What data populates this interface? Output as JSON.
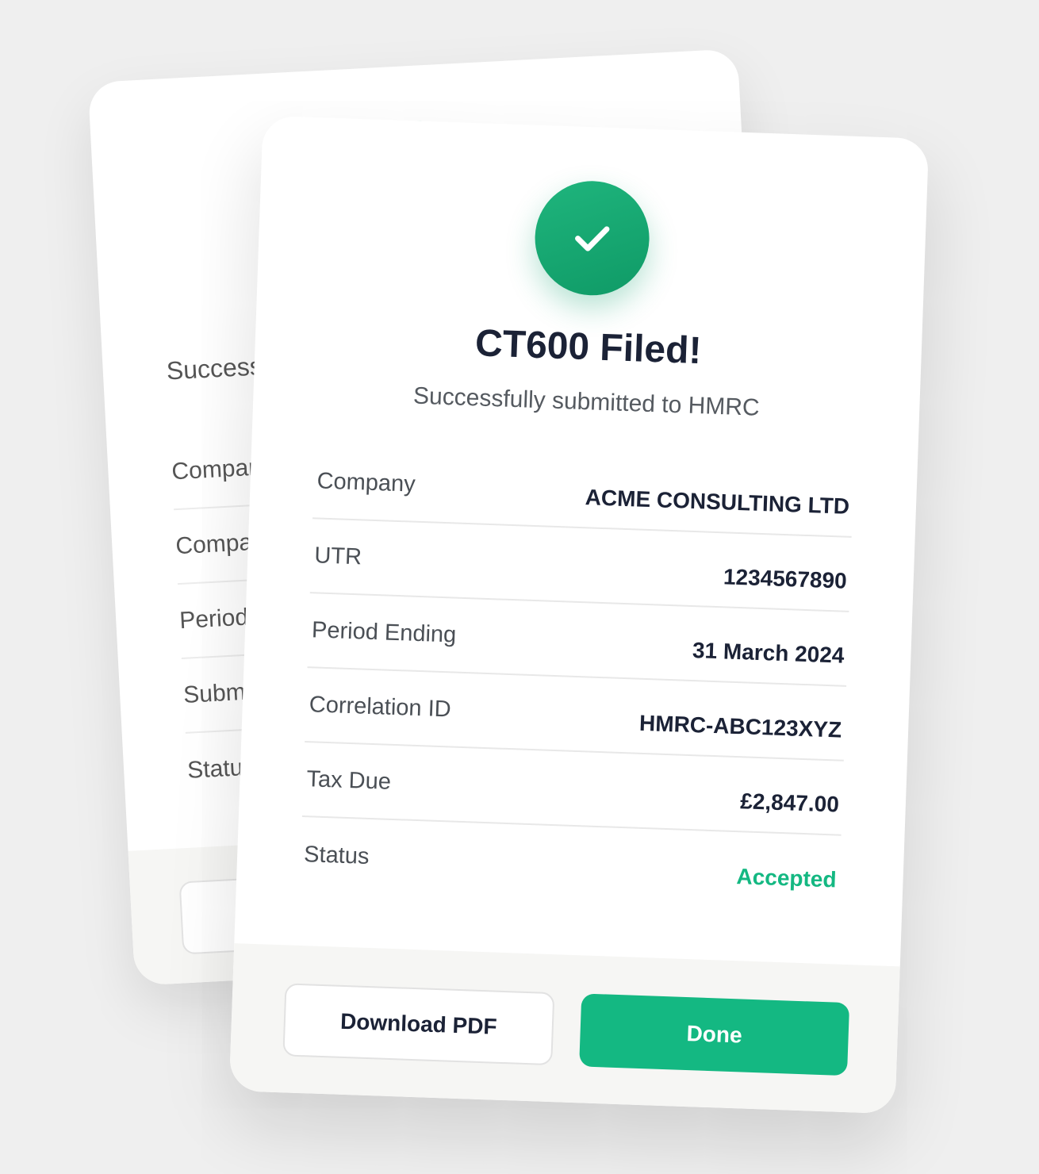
{
  "back_card": {
    "subtitle": "Successfully submitted to HMRC",
    "rows": [
      {
        "label": "Company"
      },
      {
        "label": "Company"
      },
      {
        "label": "Period"
      },
      {
        "label": "Submitted"
      },
      {
        "label": "Status"
      }
    ]
  },
  "card": {
    "title": "CT600 Filed!",
    "subtitle": "Successfully submitted to HMRC",
    "rows": [
      {
        "label": "Company",
        "value": "ACME CONSULTING LTD"
      },
      {
        "label": "UTR",
        "value": "1234567890"
      },
      {
        "label": "Period Ending",
        "value": "31 March 2024"
      },
      {
        "label": "Correlation ID",
        "value": "HMRC-ABC123XYZ"
      },
      {
        "label": "Tax Due",
        "value": "£2,847.00"
      },
      {
        "label": "Status",
        "value": "Accepted"
      }
    ],
    "buttons": {
      "download_label": "Download PDF",
      "done_label": "Done"
    }
  },
  "colors": {
    "accent": "#14b882",
    "check": "#14a370",
    "title": "#1b2236",
    "background": "#efefef"
  },
  "icons": {
    "success": "check-icon"
  }
}
